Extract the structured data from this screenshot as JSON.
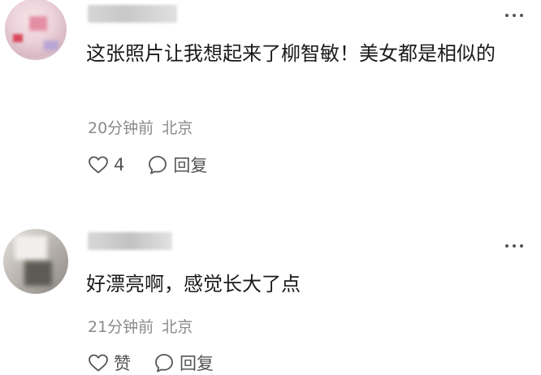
{
  "comments": [
    {
      "text": "这张照片让我想起来了柳智敏！美女都是相似的",
      "time": "20分钟前",
      "location": "北京",
      "like_label": "4",
      "reply_label": "回复"
    },
    {
      "text": "好漂亮啊，感觉长大了点",
      "time": "21分钟前",
      "location": "北京",
      "like_label": "赞",
      "reply_label": "回复"
    }
  ],
  "icons": {
    "more": "more-horizontal-icon",
    "like": "heart-outline-icon",
    "reply": "speech-bubble-icon"
  },
  "colors": {
    "text": "#1a1a1a",
    "meta": "#8a8a8a",
    "icon": "#555555"
  }
}
